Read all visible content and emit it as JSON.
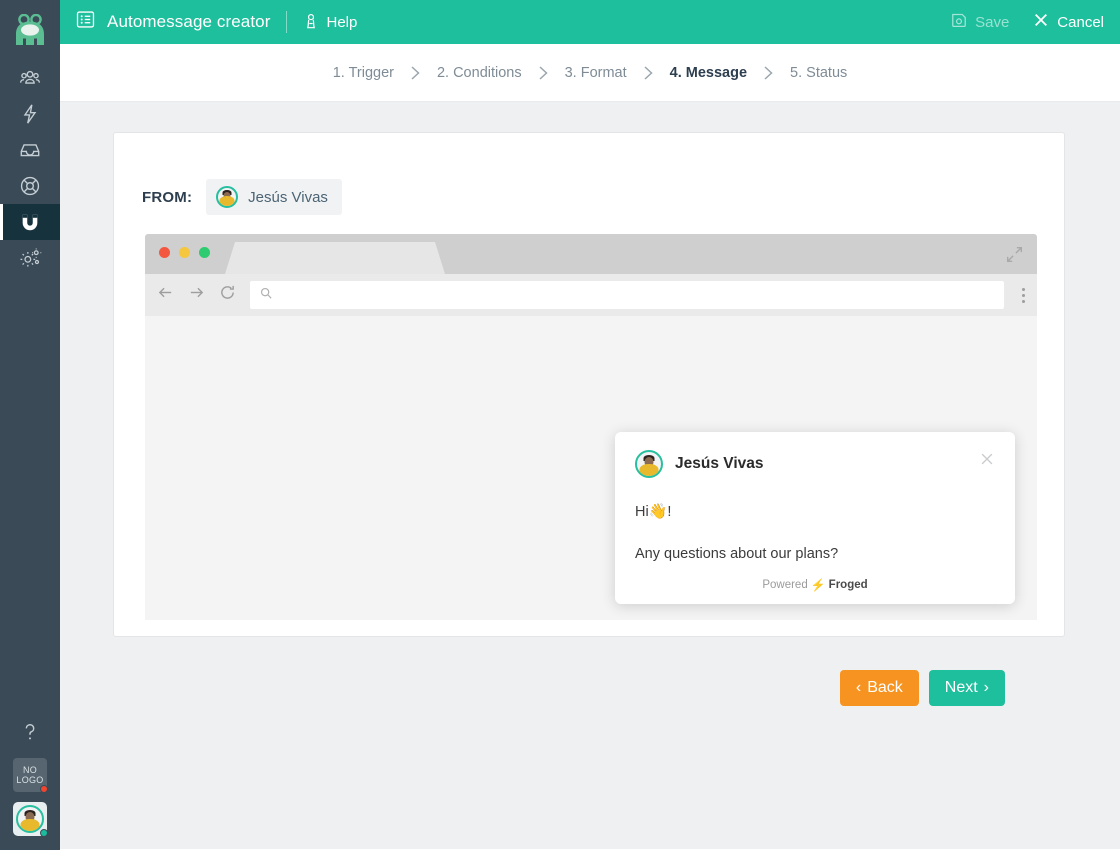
{
  "sidebar": {
    "logo_name": "froged-frog-logo",
    "items": [
      {
        "id": "users",
        "icon": "users-icon",
        "active": false
      },
      {
        "id": "triggers",
        "icon": "lightning-bolt-icon",
        "active": false
      },
      {
        "id": "inbox",
        "icon": "inbox-icon",
        "active": false
      },
      {
        "id": "help",
        "icon": "lifebuoy-icon",
        "active": false
      },
      {
        "id": "automessages",
        "icon": "magnet-icon",
        "active": true
      },
      {
        "id": "settings",
        "icon": "gears-icon",
        "active": false
      }
    ],
    "bottom": {
      "help_icon": "question-mark-icon",
      "nologo_line1": "NO",
      "nologo_line2": "LOGO",
      "nologo_status": "offline",
      "avatar_name": "user-avatar",
      "avatar_status": "online"
    }
  },
  "topbar": {
    "title_icon": "list-document-icon",
    "title": "Automessage creator",
    "help_icon": "lifebuoy-icon",
    "help_label": "Help",
    "save_icon": "floppy-disk-icon",
    "save_label": "Save",
    "cancel_icon": "close-x-icon",
    "cancel_label": "Cancel",
    "accent_color": "#1dbf9c"
  },
  "steps": [
    {
      "label": "1. Trigger",
      "active": false
    },
    {
      "label": "2. Conditions",
      "active": false
    },
    {
      "label": "3. Format",
      "active": false
    },
    {
      "label": "4. Message",
      "active": true
    },
    {
      "label": "5. Status",
      "active": false
    }
  ],
  "message_form": {
    "from_label": "FROM:",
    "from_sender": "Jesús Vivas"
  },
  "browser_preview": {
    "traffic_lights": [
      "#f4573f",
      "#f5c73f",
      "#2ecb71"
    ],
    "expand_icon": "expand-arrows-icon",
    "back_icon": "arrow-left-icon",
    "forward_icon": "arrow-right-icon",
    "reload_icon": "reload-icon",
    "search_icon": "search-icon",
    "url_value": "",
    "url_placeholder": "",
    "menu_icon": "kebab-menu-icon"
  },
  "chat_popup": {
    "sender_name": "Jesús Vivas",
    "avatar_name": "sender-avatar",
    "close_icon": "close-x-icon",
    "message_line_1_prefix": "Hi",
    "message_line_1_emoji": "👋",
    "message_line_1_suffix": "!",
    "message_line_2": "Any questions about our plans?",
    "powered_prefix": "Powered",
    "powered_bolt": "⚡",
    "powered_brand": "Froged"
  },
  "footer": {
    "back_chevron": "‹",
    "back_label": "Back",
    "next_label": "Next",
    "next_chevron": "›",
    "back_color": "#f79421",
    "next_color": "#1dbf9c"
  }
}
